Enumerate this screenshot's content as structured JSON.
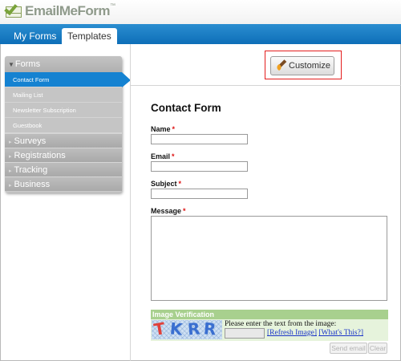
{
  "app": {
    "logo_text": "EmailMeForm",
    "logo_tm": "™"
  },
  "nav": {
    "tabs": [
      {
        "label": "My Forms",
        "active": false
      },
      {
        "label": "Templates",
        "active": true
      }
    ]
  },
  "sidebar": {
    "section": "Forms",
    "items": [
      "Contact Form",
      "Mailing List",
      "Newsletter Subscription",
      "Guestbook"
    ],
    "active_item": "Contact Form",
    "categories": [
      "Surveys",
      "Registrations",
      "Tracking",
      "Business"
    ]
  },
  "toolbar": {
    "customize_label": "Customize"
  },
  "form": {
    "title": "Contact Form",
    "required_mark": "*",
    "fields": [
      {
        "label": "Name",
        "value": ""
      },
      {
        "label": "Email",
        "value": ""
      },
      {
        "label": "Subject",
        "value": ""
      },
      {
        "label": "Message",
        "value": ""
      }
    ]
  },
  "verification": {
    "heading": "Image Verification",
    "captcha_text": "TKRR",
    "prompt": "Please enter the text from the image:",
    "input_value": "",
    "refresh_label": "[Refresh Image]",
    "whats_this_label": "[What's This?]"
  },
  "actions": {
    "send_label": "Send email",
    "clear_label": "Clear"
  },
  "colors": {
    "navbar": "#1a7fc6",
    "active_item": "#1582d1",
    "highlight_outline": "#e31d1d",
    "required": "#dd1111",
    "verification_header": "#a8d08e",
    "captcha_letters": [
      "#e0413a",
      "#3a6fd0",
      "#3a6fd0",
      "#3a6fd0"
    ]
  }
}
